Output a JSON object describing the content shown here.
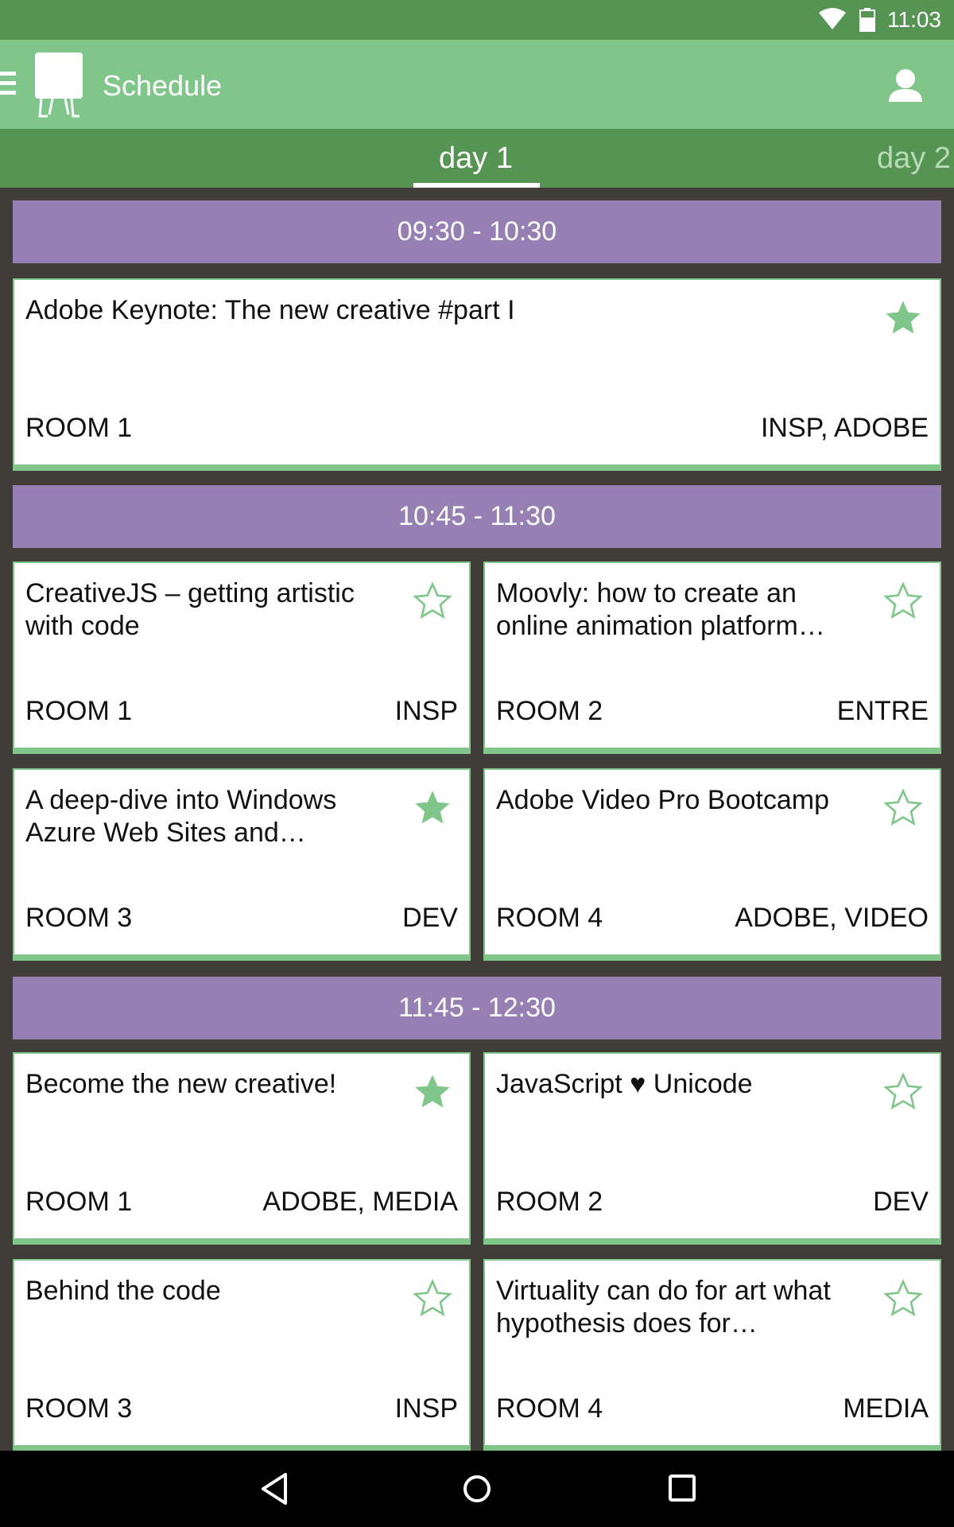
{
  "status_bar": {
    "time": "11:03",
    "icons": [
      "wifi-icon",
      "battery-icon"
    ]
  },
  "app_bar": {
    "title": "Schedule",
    "icons": [
      "menu-icon",
      "app-logo",
      "profile-icon"
    ]
  },
  "tabs": [
    {
      "label": "day 1",
      "selected": true
    },
    {
      "label": "day 2",
      "selected": false
    }
  ],
  "slots": [
    {
      "time": "09:30 - 10:30",
      "sessions": [
        {
          "title": "Adobe Keynote: The new creative #part I",
          "room": "ROOM 1",
          "tags": "INSP, ADOBE",
          "starred": true
        }
      ]
    },
    {
      "time": "10:45 - 11:30",
      "sessions": [
        {
          "title": "CreativeJS – getting artistic with code",
          "room": "ROOM 1",
          "tags": "INSP",
          "starred": false
        },
        {
          "title": "Moovly: how to create an online animation platform…",
          "room": "ROOM 2",
          "tags": "ENTRE",
          "starred": false
        },
        {
          "title": "A deep-dive into Windows Azure Web Sites and…",
          "room": "ROOM 3",
          "tags": "DEV",
          "starred": true
        },
        {
          "title": "Adobe Video Pro Bootcamp",
          "room": "ROOM 4",
          "tags": "ADOBE, VIDEO",
          "starred": false
        }
      ]
    },
    {
      "time": "11:45 - 12:30",
      "sessions": [
        {
          "title": "Become the new creative!",
          "room": "ROOM 1",
          "tags": "ADOBE, MEDIA",
          "starred": true
        },
        {
          "title": "JavaScript ♥ Unicode",
          "room": "ROOM 2",
          "tags": "DEV",
          "starred": false
        },
        {
          "title": "Behind the code",
          "room": "ROOM 3",
          "tags": "INSP",
          "starred": false
        },
        {
          "title": "Virtuality can do for art what hypothesis does for…",
          "room": "ROOM 4",
          "tags": "MEDIA",
          "starred": false
        }
      ]
    }
  ],
  "nav_bar": {
    "icons": [
      "back-icon",
      "home-icon",
      "recents-icon"
    ]
  },
  "colors": {
    "primary": "#559452",
    "primary_light": "#80c68a",
    "slot_header": "#9680b3",
    "background": "#403c38"
  }
}
